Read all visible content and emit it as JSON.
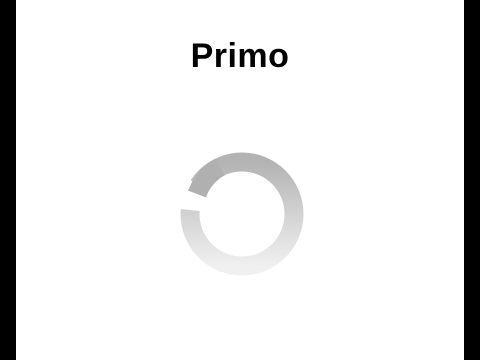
{
  "app": {
    "title": "Primo"
  },
  "loading_indicator": {
    "icon": "loading-spinner-icon",
    "colors": {
      "dark": "#b3b3b3",
      "light": "#f0f0f0",
      "background": "#ffffff"
    }
  }
}
